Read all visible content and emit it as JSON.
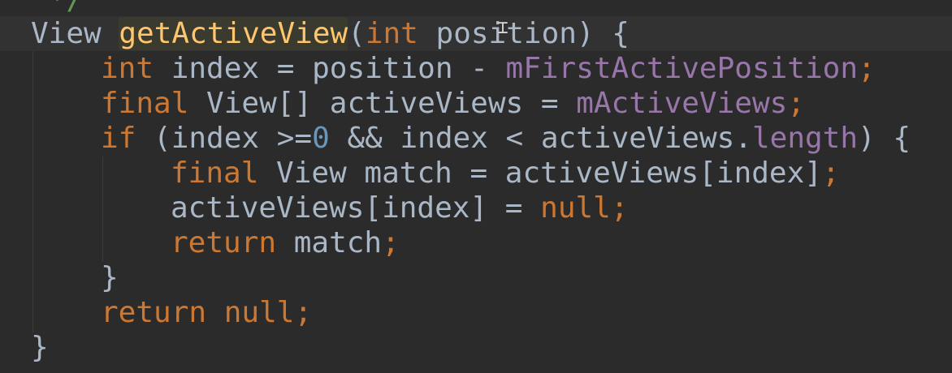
{
  "editor": {
    "lines": [
      {
        "tokens": [
          {
            "t": " */",
            "c": "cmt"
          }
        ]
      },
      {
        "tokens": [
          {
            "t": "View ",
            "c": ""
          },
          {
            "t": "getActiveView",
            "c": "fn hl"
          },
          {
            "t": "(",
            "c": ""
          },
          {
            "t": "int",
            "c": "kw"
          },
          {
            "t": " position) {",
            "c": ""
          }
        ]
      },
      {
        "tokens": [
          {
            "t": "int",
            "c": "kw"
          },
          {
            "t": " index = position - ",
            "c": ""
          },
          {
            "t": "mFirstActivePosition",
            "c": "fld"
          },
          {
            "t": ";",
            "c": "kw"
          }
        ]
      },
      {
        "tokens": [
          {
            "t": "final",
            "c": "kw"
          },
          {
            "t": " View[] activeViews = ",
            "c": ""
          },
          {
            "t": "mActiveViews",
            "c": "fld"
          },
          {
            "t": ";",
            "c": "kw"
          }
        ]
      },
      {
        "tokens": [
          {
            "t": "if",
            "c": "kw"
          },
          {
            "t": " (index >=",
            "c": ""
          },
          {
            "t": "0",
            "c": "num"
          },
          {
            "t": " && index < activeViews.",
            "c": ""
          },
          {
            "t": "length",
            "c": "fld"
          },
          {
            "t": ") {",
            "c": ""
          }
        ]
      },
      {
        "tokens": [
          {
            "t": "final",
            "c": "kw"
          },
          {
            "t": " View match = activeViews[index]",
            "c": ""
          },
          {
            "t": ";",
            "c": "kw"
          }
        ]
      },
      {
        "tokens": [
          {
            "t": "activeViews[index] = ",
            "c": ""
          },
          {
            "t": "null",
            "c": "kw"
          },
          {
            "t": ";",
            "c": "kw"
          }
        ]
      },
      {
        "tokens": [
          {
            "t": "return",
            "c": "kw"
          },
          {
            "t": " match",
            "c": ""
          },
          {
            "t": ";",
            "c": "kw"
          }
        ]
      },
      {
        "tokens": [
          {
            "t": "}",
            "c": ""
          }
        ]
      },
      {
        "tokens": [
          {
            "t": "return",
            "c": "kw"
          },
          {
            "t": " ",
            "c": ""
          },
          {
            "t": "null",
            "c": "kw"
          },
          {
            "t": ";",
            "c": "kw"
          }
        ]
      },
      {
        "tokens": [
          {
            "t": "}",
            "c": ""
          }
        ]
      }
    ]
  },
  "colors": {
    "background": "#2b2b2b",
    "current_line": "#323232",
    "text": "#a9b7c6",
    "keyword": "#cc7832",
    "field": "#9876aa",
    "number": "#6897bb",
    "comment": "#629755",
    "method": "#ffc66d"
  },
  "cursor_icon": "text-cursor-icon"
}
